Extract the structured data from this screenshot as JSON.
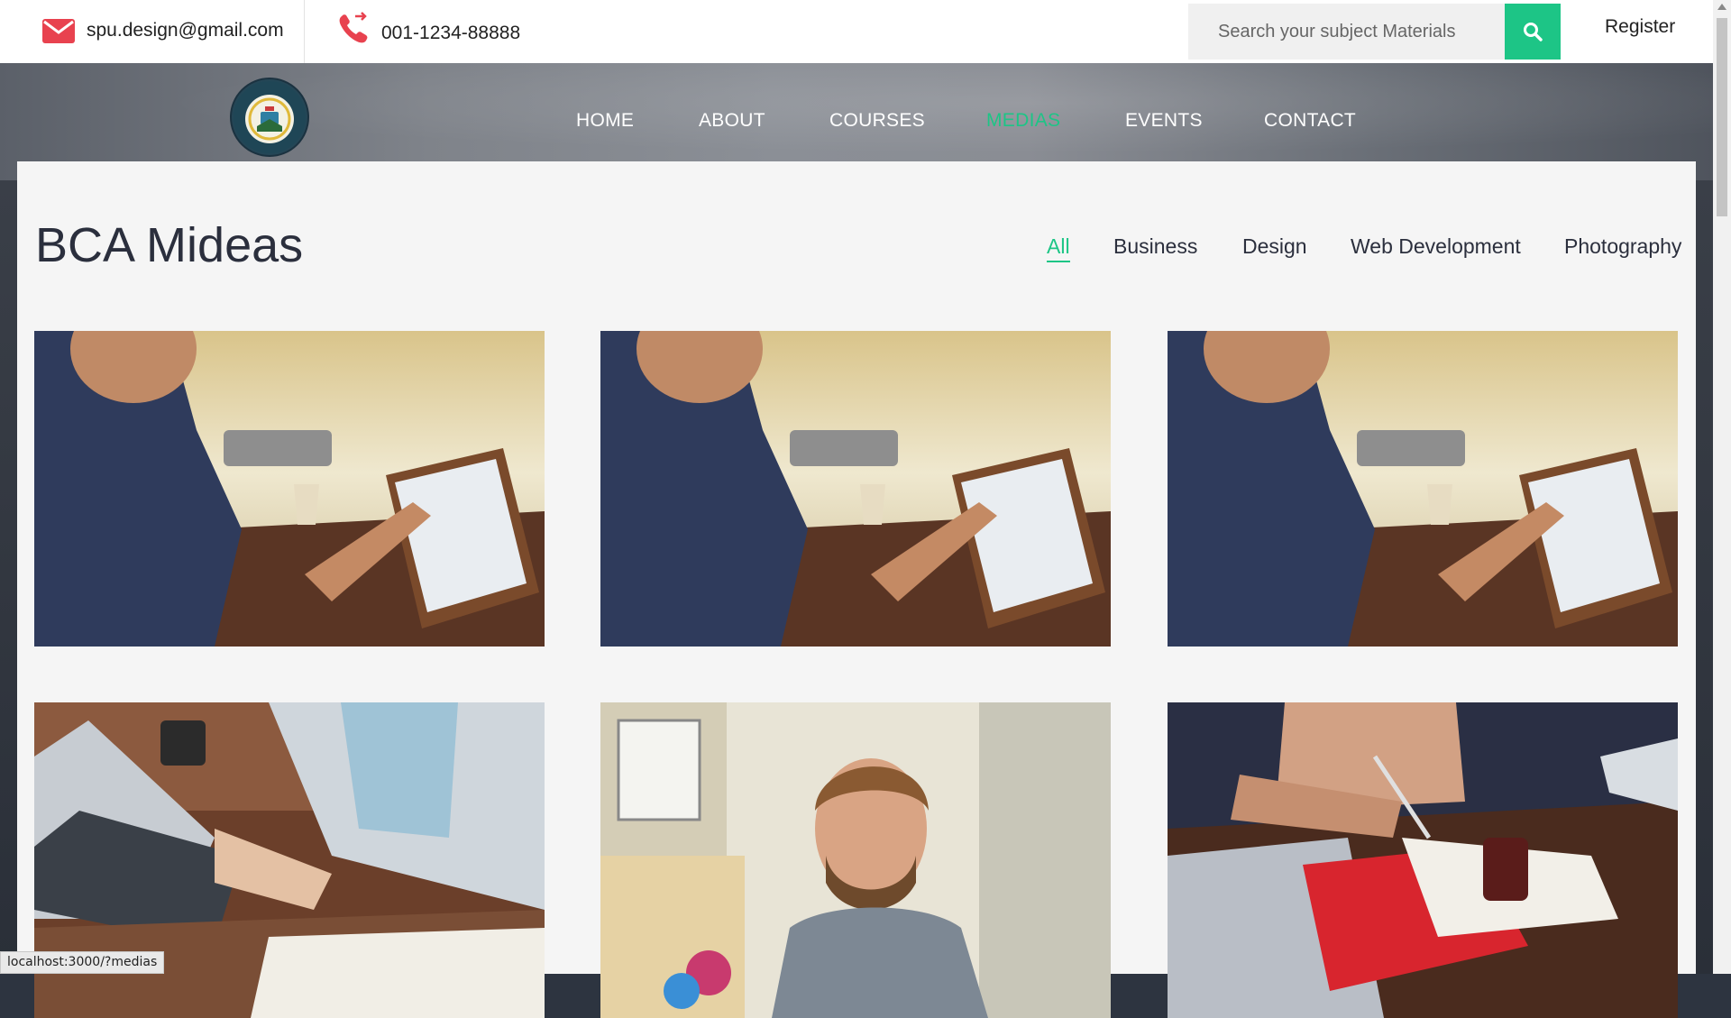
{
  "topbar": {
    "email": "spu.design@gmail.com",
    "phone": "001-1234-88888",
    "search_placeholder": "Search your subject Materials",
    "register_label": "Register"
  },
  "nav": {
    "items": [
      {
        "label": "HOME"
      },
      {
        "label": "ABOUT"
      },
      {
        "label": "COURSES"
      },
      {
        "label": "MEDIAS",
        "active": true
      },
      {
        "label": "EVENTS"
      },
      {
        "label": "CONTACT"
      }
    ]
  },
  "content": {
    "title": "BCA Mideas",
    "filters": [
      {
        "label": "All",
        "active": true
      },
      {
        "label": "Business"
      },
      {
        "label": "Design"
      },
      {
        "label": "Web Development"
      },
      {
        "label": "Photography"
      }
    ],
    "media_items": [
      {
        "icon": "man-with-tablet-photo"
      },
      {
        "icon": "man-with-tablet-photo"
      },
      {
        "icon": "man-with-tablet-photo"
      },
      {
        "icon": "woman-typing-laptop-photo"
      },
      {
        "icon": "man-at-desk-photo"
      },
      {
        "icon": "people-writing-notes-photo"
      }
    ]
  },
  "statusbar": {
    "url": "localhost:3000/?medias"
  },
  "colors": {
    "accent": "#1dc586",
    "mail_icon": "#e8424f",
    "title_text": "#2b2f3d",
    "panel_bg": "#f5f5f5"
  }
}
